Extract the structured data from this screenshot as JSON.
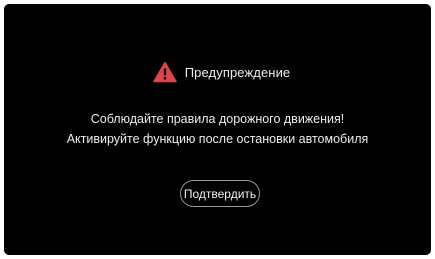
{
  "dialog": {
    "icon": "warning-triangle-icon",
    "accent_color": "#e0434b",
    "title": "Предупреждение",
    "message_line1": "Соблюдайте правила дорожного движения!",
    "message_line2": "Активируйте функцию после остановки автомобиля",
    "confirm_label": "Подтвердить"
  }
}
